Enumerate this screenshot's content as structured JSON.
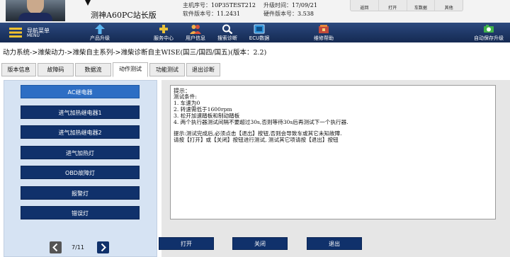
{
  "header": {
    "station_name": "测神A60PC站长版",
    "host_label": "主机序号：",
    "host_value": "10P35TEST212",
    "upgrade_label": "升级时间：",
    "upgrade_value": "17/09/21",
    "software_label": "软件版本号：",
    "software_value": "11.2431",
    "hardware_label": "硬件版本号：",
    "hardware_value": "3.538",
    "quick_buttons": [
      "返回",
      "打开",
      "车数据",
      "其他"
    ]
  },
  "toolbar": {
    "nav_menu": "导航菜单",
    "nav_menu_en": "MENU",
    "product_upgrade": "产品升级",
    "service_center": "服务中心",
    "user_info": "用户信息",
    "search_diag": "搜索诊断",
    "ecu_data": "ECU数据",
    "repair_help": "维修帮助",
    "auto_save": "自动保存升级"
  },
  "breadcrumb": "动力系统->潍柴动力->潍柴自主系列->潍柴诊断自主WISE(国三/国四/国五)(版本：2.2)",
  "tabs": [
    "版本信息",
    "故障码",
    "数据流",
    "动作测试",
    "功能测试",
    "退出诊断"
  ],
  "active_tab": "动作测试",
  "actuators": [
    "AC继电器",
    "进气加热继电器1",
    "进气加热继电器2",
    "进气加热灯",
    "OBD故障灯",
    "报警灯",
    "错误灯"
  ],
  "selected_actuator": "AC继电器",
  "pager": {
    "text": "7/11"
  },
  "hint": {
    "title": "提示：",
    "lines": [
      "测试条件:",
      "1. 车速为0",
      "2. 转速需低于1600rpm",
      "3. 松开加速踏板和制动踏板",
      "4. 两个执行器测试间隔不要超过30s,否则等待30s后再测试下一个执行器.",
      "",
      "提示:测试完成后,必须点击【退出】按钮,否则会导致车或其它未知故障.",
      "请按【打开】或【关闭】按钮进行测试, 测试其它项请按【退出】按钮"
    ]
  },
  "buttons": {
    "open": "打开",
    "close": "关闭",
    "exit": "退出"
  },
  "colors": {
    "toolbar": "#1e3766",
    "button": "#10316b",
    "selected": "#2d6ec4",
    "left_pane": "#d6e3f3"
  },
  "icons": [
    "nav-menu-icon",
    "upgrade-arrow-icon",
    "service-center-icon",
    "user-info-icon",
    "search-icon",
    "ecu-data-icon",
    "repair-help-icon",
    "auto-save-icon",
    "chevron-left-icon",
    "chevron-right-icon"
  ]
}
